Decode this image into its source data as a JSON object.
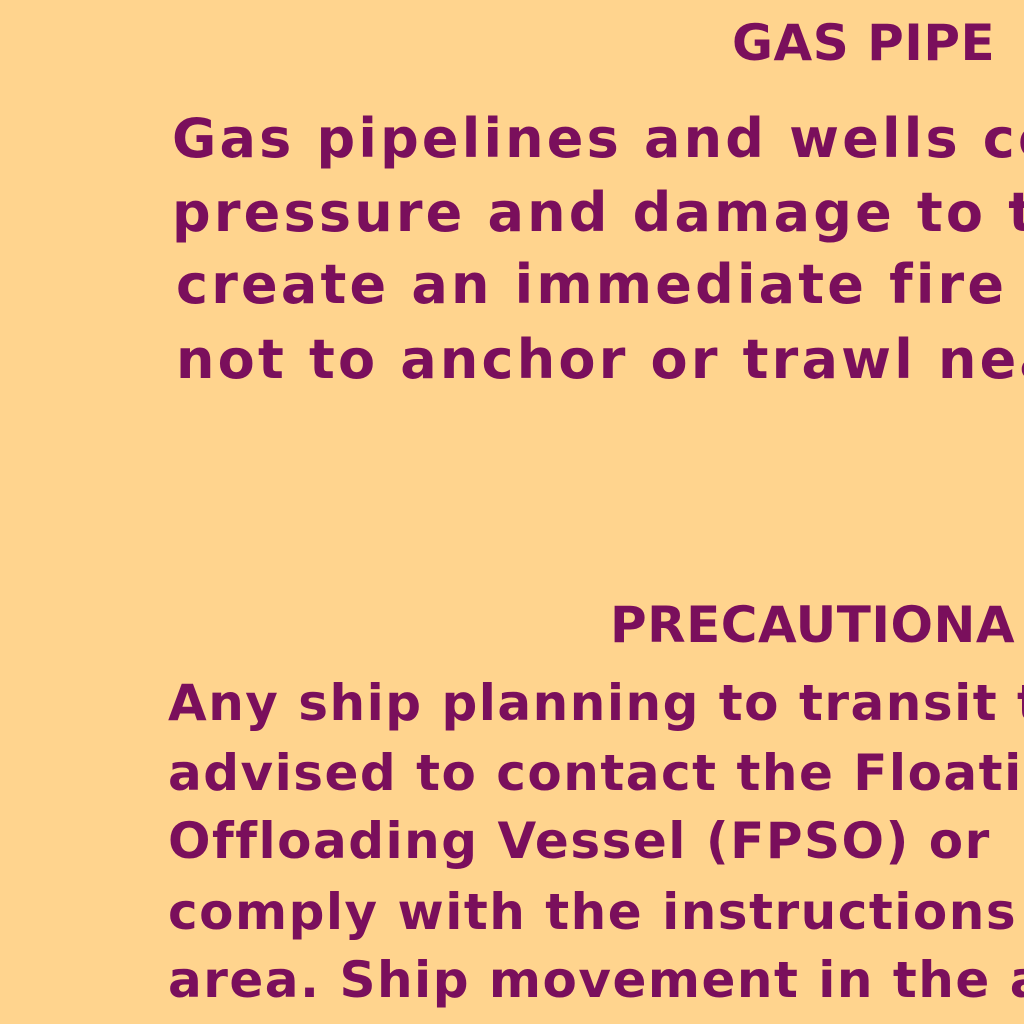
{
  "chart_notes": {
    "gas_pipelines": {
      "heading": "GAS PIPE",
      "lines": [
        "Gas pipelines and wells co",
        "pressure and damage to th",
        "create an immediate fire haza",
        "not to anchor or trawl near pi"
      ]
    },
    "precautionary": {
      "heading": "PRECAUTIONA",
      "lines": [
        "Any ship planning to transit t",
        "advised to contact the Floating",
        "Offloading Vessel (FPSO) or",
        "comply with the instructions g",
        "area. Ship movement in the a"
      ]
    }
  },
  "colors": {
    "background": "#FFD48E",
    "text": "#7A0F5C"
  }
}
